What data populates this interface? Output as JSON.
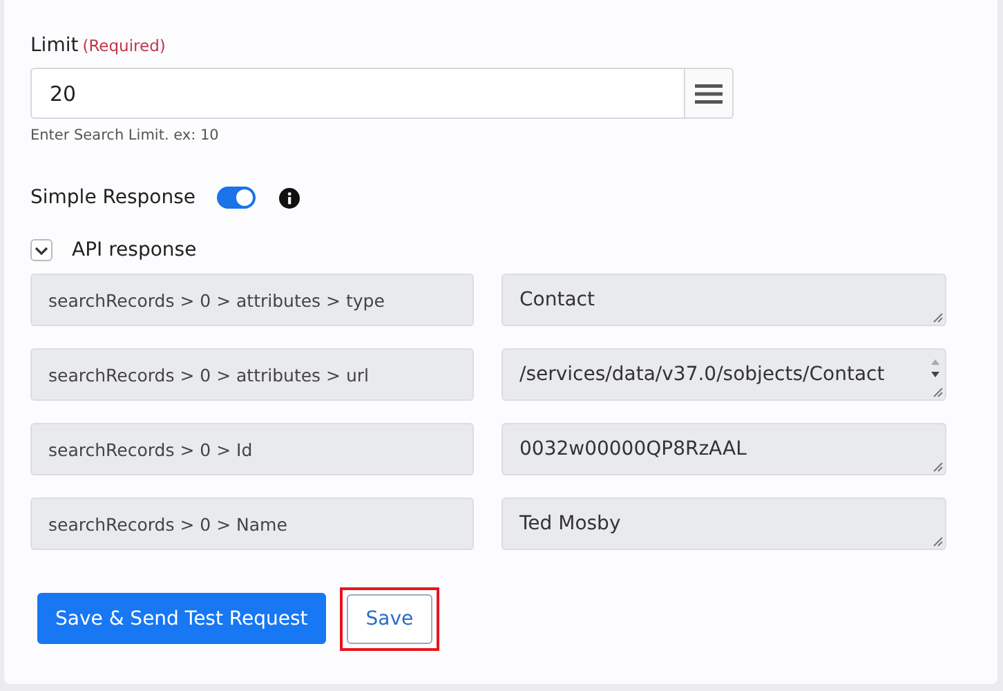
{
  "limit_field": {
    "label": "Limit",
    "required_text": "(Required)",
    "value": "20",
    "hint": "Enter Search Limit. ex: 10"
  },
  "simple_response": {
    "label": "Simple Response",
    "on": true
  },
  "api_response": {
    "label": "API response",
    "expanded": true,
    "rows": [
      {
        "key": "searchRecords > 0 > attributes > type",
        "value": "Contact",
        "scrollable": false
      },
      {
        "key": "searchRecords > 0 > attributes > url",
        "value": "/services/data/v37.0/sobjects/Contact",
        "scrollable": true
      },
      {
        "key": "searchRecords > 0 > Id",
        "value": "0032w00000QP8RzAAL",
        "scrollable": false
      },
      {
        "key": "searchRecords > 0 > Name",
        "value": "Ted Mosby",
        "scrollable": false
      }
    ]
  },
  "buttons": [
    {
      "label": "Save & Send Test Request",
      "kind": "primary",
      "highlighted": false
    },
    {
      "label": "Save",
      "kind": "outline",
      "highlighted": true
    }
  ]
}
